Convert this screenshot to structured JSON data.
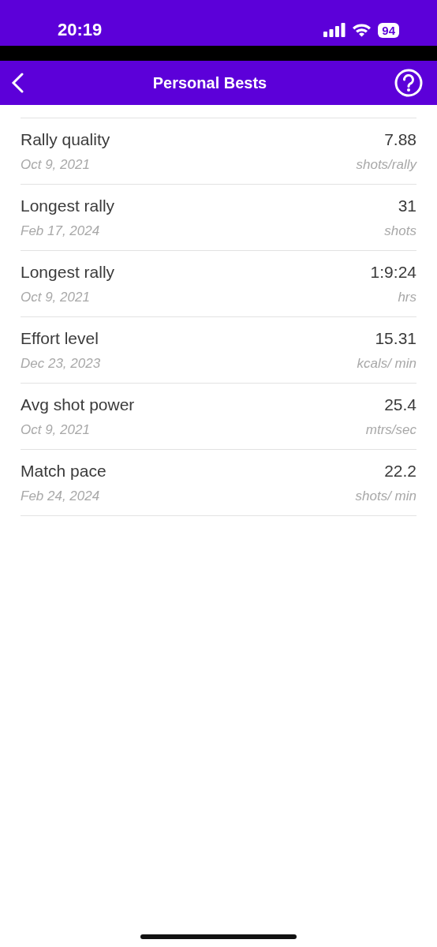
{
  "status_bar": {
    "time": "20:19",
    "battery": "94"
  },
  "nav": {
    "title": "Personal Bests"
  },
  "records": [
    {
      "name": "Rally quality",
      "date": "Oct 9, 2021",
      "value": "7.88",
      "unit": "shots/rally"
    },
    {
      "name": "Longest rally",
      "date": "Feb 17, 2024",
      "value": "31",
      "unit": "shots"
    },
    {
      "name": "Longest rally",
      "date": "Oct 9, 2021",
      "value": "1:9:24",
      "unit": "hrs"
    },
    {
      "name": "Effort level",
      "date": "Dec 23, 2023",
      "value": "15.31",
      "unit": "kcals/ min"
    },
    {
      "name": "Avg shot power",
      "date": "Oct 9, 2021",
      "value": "25.4",
      "unit": "mtrs/sec"
    },
    {
      "name": "Match pace",
      "date": "Feb 24, 2024",
      "value": "22.2",
      "unit": "shots/ min"
    }
  ]
}
